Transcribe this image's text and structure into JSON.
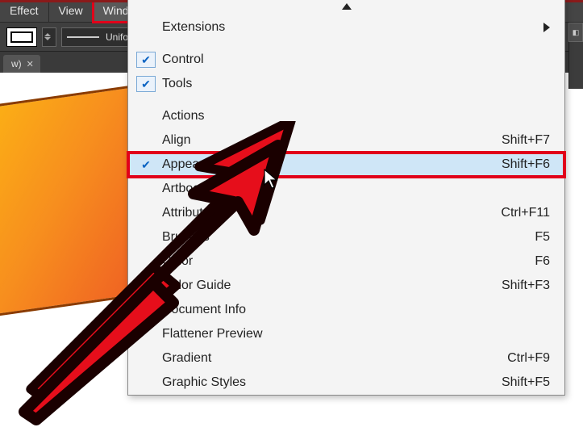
{
  "menubar": {
    "items": [
      "Effect",
      "View",
      "Window"
    ],
    "highlighted_index": 2
  },
  "toolbar": {
    "stroke_profile_label": "Uniform"
  },
  "tabs": {
    "active": "w)"
  },
  "dropdown": {
    "rows": [
      {
        "label": "Extensions",
        "shortcut": "",
        "checked": false,
        "submenu": true
      },
      {
        "label": "Control",
        "shortcut": "",
        "checked": true,
        "boxed": true
      },
      {
        "label": "Tools",
        "shortcut": "",
        "checked": true,
        "boxed": true
      },
      {
        "label": "Actions",
        "shortcut": "",
        "checked": false
      },
      {
        "label": "Align",
        "shortcut": "Shift+F7",
        "checked": false
      },
      {
        "label": "Appearance",
        "shortcut": "Shift+F6",
        "checked": true,
        "selected": true
      },
      {
        "label": "Artboards",
        "shortcut": "",
        "checked": false
      },
      {
        "label": "Attributes",
        "shortcut": "Ctrl+F11",
        "checked": false
      },
      {
        "label": "Brushes",
        "shortcut": "F5",
        "checked": false
      },
      {
        "label": "Color",
        "shortcut": "F6",
        "checked": false
      },
      {
        "label": "Color Guide",
        "shortcut": "Shift+F3",
        "checked": false
      },
      {
        "label": "Document Info",
        "shortcut": "",
        "checked": false
      },
      {
        "label": "Flattener Preview",
        "shortcut": "",
        "checked": false
      },
      {
        "label": "Gradient",
        "shortcut": "Ctrl+F9",
        "checked": false
      },
      {
        "label": "Graphic Styles",
        "shortcut": "Shift+F5",
        "checked": false
      }
    ]
  },
  "dock": {
    "widget_glyph": "◧"
  }
}
